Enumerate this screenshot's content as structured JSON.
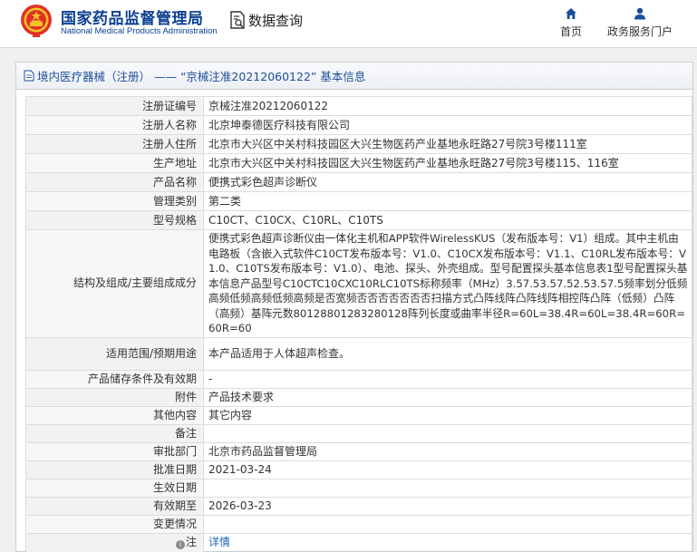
{
  "header": {
    "brand_cn": "国家药品监督管理局",
    "brand_en": "National Medical Products Administration",
    "query_label": "数据查询",
    "nav": {
      "home": "首页",
      "portal": "政务服务门户"
    },
    "icons": {
      "emblem": "national-emblem-icon",
      "query": "document-search-icon",
      "home": "home-icon",
      "portal": "user-icon"
    },
    "colors": {
      "brand": "#0b3f93",
      "nav_icon": "#1d4e9b"
    }
  },
  "breadcrumb": {
    "title": "境内医疗器械（注册） —— “京械注准20212060122” 基本信息"
  },
  "table": {
    "rows": [
      {
        "label": "注册证编号",
        "value": "京械注准20212060122"
      },
      {
        "label": "注册人名称",
        "value": "北京坤泰德医疗科技有限公司"
      },
      {
        "label": "注册人住所",
        "value": "北京市大兴区中关村科技园区大兴生物医药产业基地永旺路27号院3号楼111室"
      },
      {
        "label": "生产地址",
        "value": "北京市大兴区中关村科技园区大兴生物医药产业基地永旺路27号院3号楼115、116室"
      },
      {
        "label": "产品名称",
        "value": "便携式彩色超声诊断仪"
      },
      {
        "label": "管理类别",
        "value": "第二类"
      },
      {
        "label": "型号规格",
        "value": "C10CT、C10CX、C10RL、C10TS"
      },
      {
        "label": "结构及组成/主要组成成分",
        "value": "便携式彩色超声诊断仪由一体化主机和APP软件WirelessKUS（发布版本号：V1）组成。其中主机由电路板（含嵌入式软件C10CT发布版本号：V1.0、C10CX发布版本号：V1.1、C10RL发布版本号：V1.0、C10TS发布版本号：V1.0）、电池、探头、外壳组成。型号配置探头基本信息表1型号配置探头基本信息产品型号C10CTC10CXC10RLC10TS标称频率（MHz）3.57.53.57.52.53.57.5频率划分低频高频低频高频低频高频是否宽频否否否否否否否扫描方式凸阵线阵凸阵线阵相控阵凸阵（低频）凸阵（高频）基阵元数80128801283280128阵列长度或曲率半径R=60L=38.4R=60L=38.4R=60R=60R=60"
      },
      {
        "label": "适用范围/预期用途",
        "value": "本产品适用于人体超声检查。"
      },
      {
        "label": "产品储存条件及有效期",
        "value": "-"
      },
      {
        "label": "附件",
        "value": "产品技术要求"
      },
      {
        "label": "其他内容",
        "value": "其它内容"
      },
      {
        "label": "备注",
        "value": ""
      },
      {
        "label": "审批部门",
        "value": "北京市药品监督管理局"
      },
      {
        "label": "批准日期",
        "value": "2021-03-24"
      },
      {
        "label": "生效日期",
        "value": ""
      },
      {
        "label": "有效期至",
        "value": "2026-03-23"
      },
      {
        "label": "变更情况",
        "value": ""
      }
    ],
    "note": {
      "label": "注",
      "link": "详情",
      "icon": "info-circle-icon"
    }
  }
}
